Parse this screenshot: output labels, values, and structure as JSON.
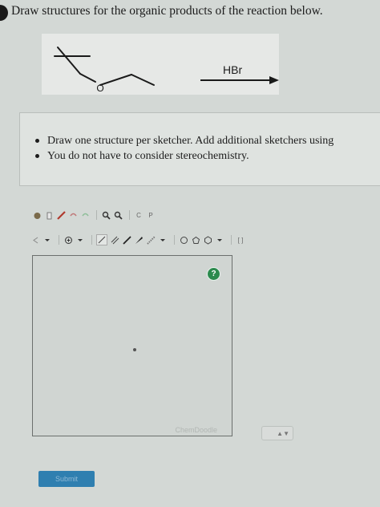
{
  "question": {
    "prompt": "Draw structures for the organic products of the reaction below.",
    "reaction": {
      "reagent": "HBr",
      "ether_oxygen": "O"
    }
  },
  "instructions": {
    "items": [
      "Draw one structure per sketcher. Add additional sketchers using",
      "You do not have to consider stereochemistry."
    ]
  },
  "toolbar1": {
    "icons": [
      "hand-icon",
      "eraser-icon",
      "pencil-icon",
      "undo-icon",
      "redo-icon",
      "zoom-in-icon",
      "zoom-out-icon",
      "copy-icon",
      "paste-icon"
    ],
    "copy_label": "C",
    "paste_label": "P"
  },
  "toolbar2": {
    "icons": [
      "charge-icon",
      "single-bond-icon",
      "double-bond-icon",
      "triple-bond-icon",
      "wedge-bond-icon",
      "ring-icon",
      "bracket-icon"
    ],
    "bracket_label": "[ ]"
  },
  "sketcher": {
    "help_label": "?",
    "brand": "ChemDoodle"
  },
  "sketcher_count": {
    "arrows": "▲▼"
  },
  "submit_label": "Submit",
  "colors": {
    "submit": "#2f7fb0",
    "help": "#2c8a4e"
  }
}
